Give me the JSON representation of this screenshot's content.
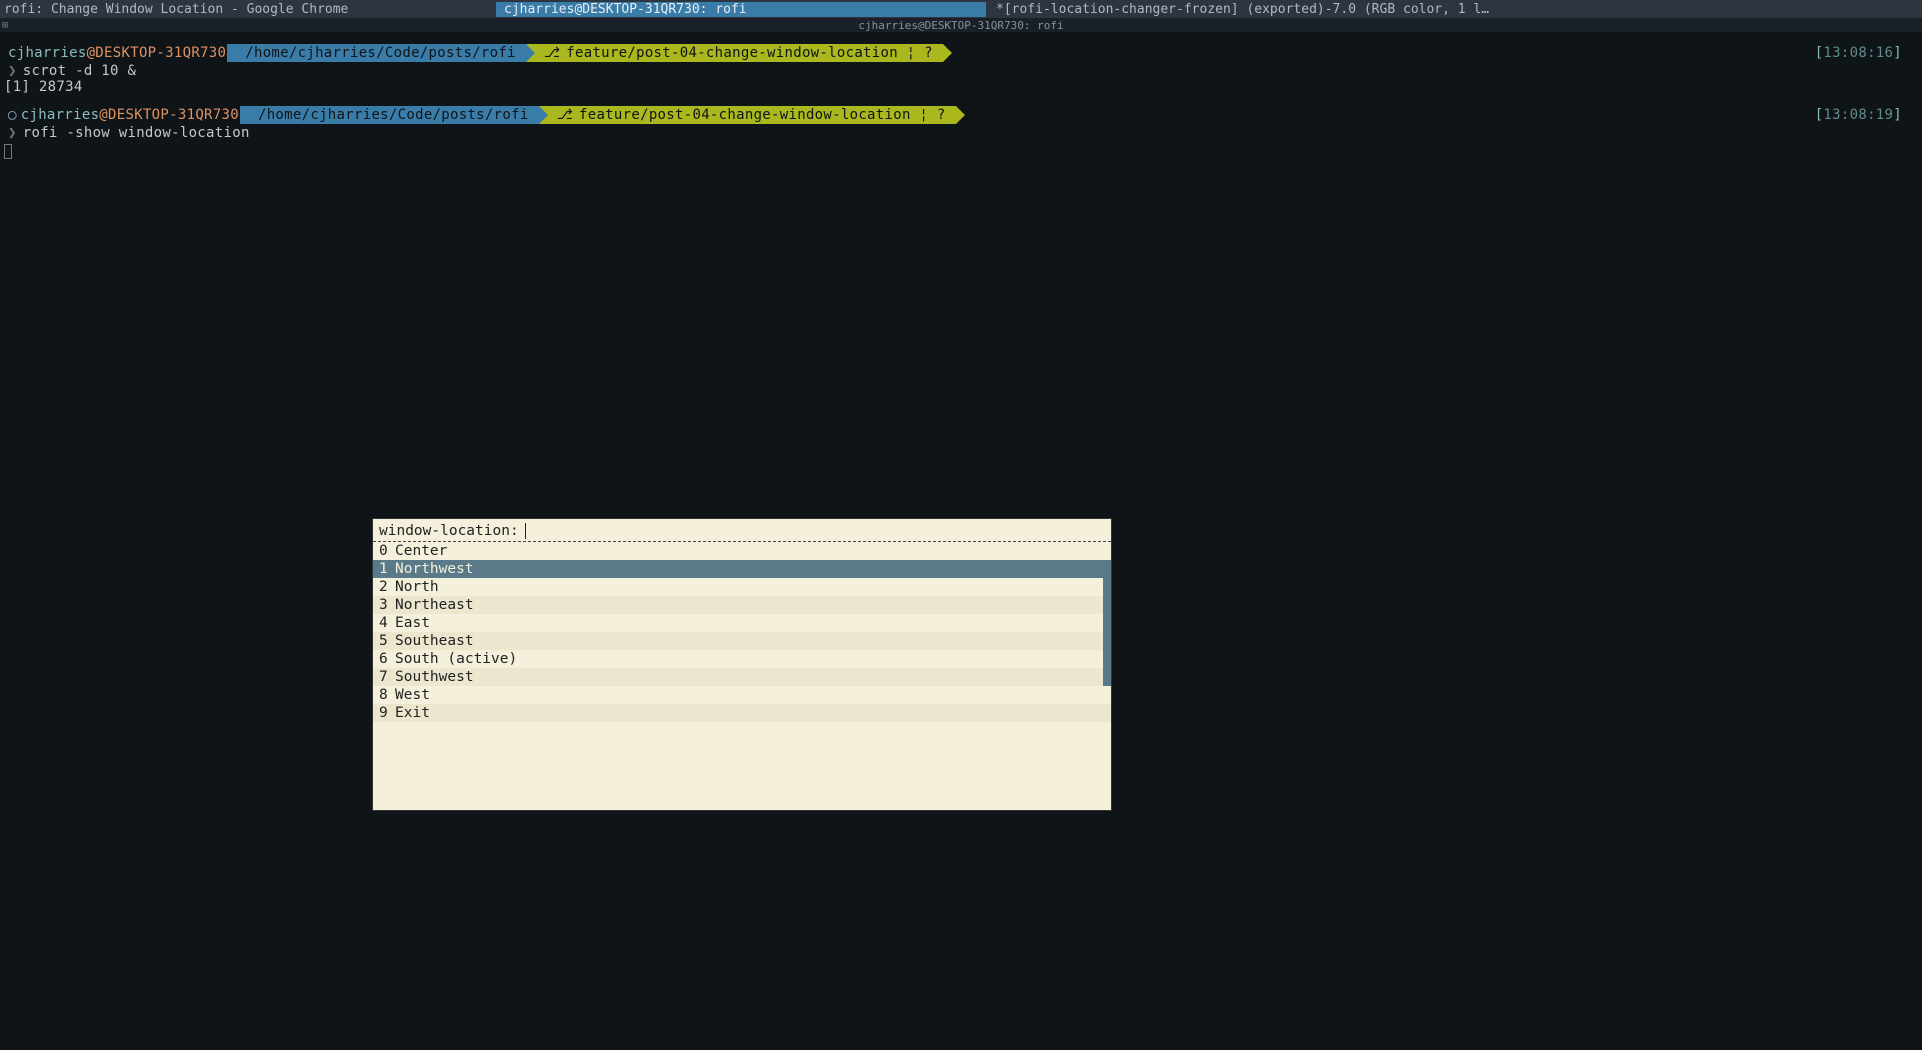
{
  "titlebar": {
    "left": "rofi: Change Window Location - Google Chrome",
    "center": "cjharries@DESKTOP-31QR730: rofi",
    "right": "*[rofi-location-changer-frozen] (exported)-7.0 (RGB color, 1 l…"
  },
  "tabbar": {
    "label": "cjharries@DESKTOP-31QR730: rofi"
  },
  "prompts": [
    {
      "user": "cjharries",
      "at": "@",
      "host": "DESKTOP-31QR730",
      "path": "/home/cjharries/Code/posts/rofi",
      "branch": "feature/post-04-change-window-location ¦ ?",
      "time": "13:08:16",
      "command": "scrot -d 10 &",
      "output": "[1] 28734",
      "has_circle": false
    },
    {
      "user": "cjharries",
      "at": "@",
      "host": "DESKTOP-31QR730",
      "path": "/home/cjharries/Code/posts/rofi",
      "branch": "feature/post-04-change-window-location ¦ ?",
      "time": "13:08:19",
      "command": "rofi -show window-location",
      "output": "",
      "has_circle": true
    }
  ],
  "rofi": {
    "prompt_label": "window-location:",
    "input_value": "",
    "selected_index": 1,
    "items": [
      {
        "idx": "0",
        "label": "Center"
      },
      {
        "idx": "1",
        "label": "Northwest"
      },
      {
        "idx": "2",
        "label": "North"
      },
      {
        "idx": "3",
        "label": "Northeast"
      },
      {
        "idx": "4",
        "label": "East"
      },
      {
        "idx": "5",
        "label": "Southeast"
      },
      {
        "idx": "6",
        "label": "South (active)"
      },
      {
        "idx": "7",
        "label": "Southwest"
      },
      {
        "idx": "8",
        "label": "West"
      },
      {
        "idx": "9",
        "label": "Exit"
      }
    ]
  }
}
